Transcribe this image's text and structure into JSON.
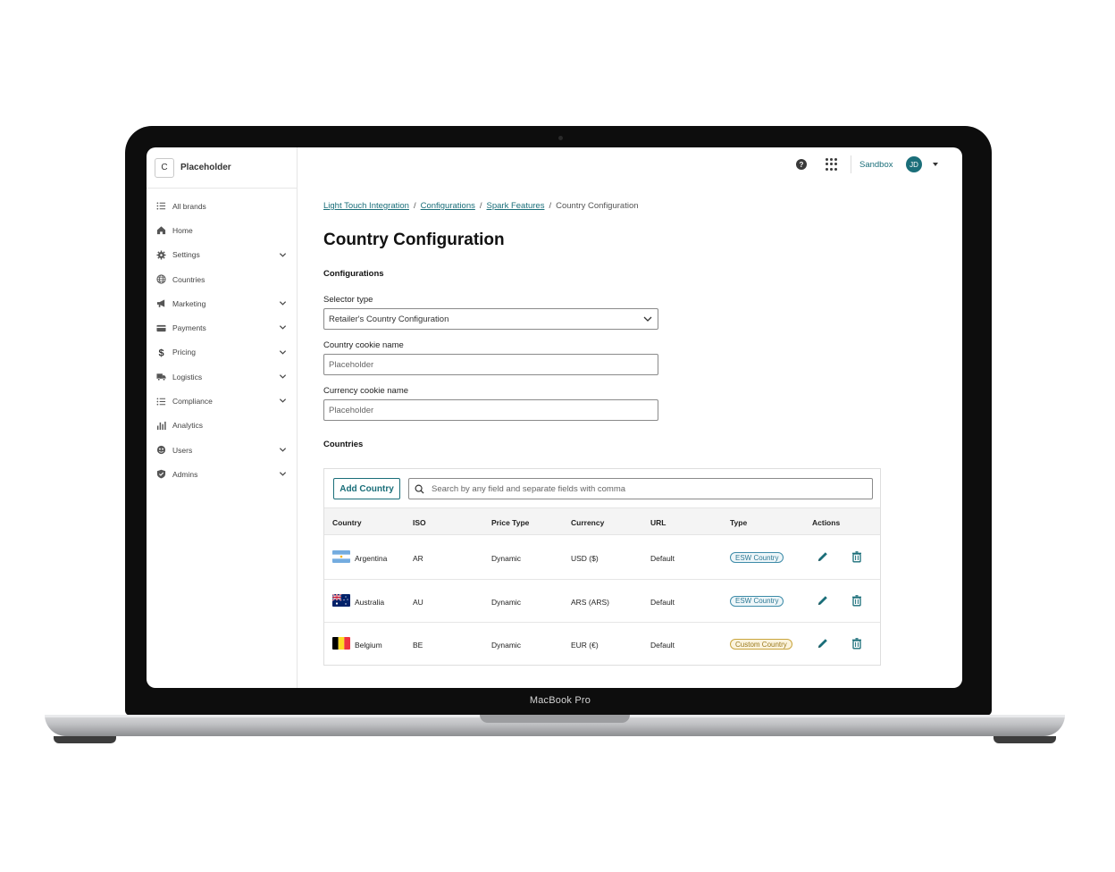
{
  "device": {
    "model_label": "MacBook Pro"
  },
  "sidebar": {
    "brand_initial": "C",
    "brand_name": "Placeholder",
    "items": [
      {
        "label": "All brands",
        "icon": "list-icon",
        "expandable": false
      },
      {
        "label": "Home",
        "icon": "home-icon",
        "expandable": false
      },
      {
        "label": "Settings",
        "icon": "gear-icon",
        "expandable": true
      },
      {
        "label": "Countries",
        "icon": "globe-icon",
        "expandable": false
      },
      {
        "label": "Marketing",
        "icon": "megaphone-icon",
        "expandable": true
      },
      {
        "label": "Payments",
        "icon": "credit-card-icon",
        "expandable": true
      },
      {
        "label": "Pricing",
        "icon": "dollar-icon",
        "expandable": true
      },
      {
        "label": "Logistics",
        "icon": "truck-icon",
        "expandable": true
      },
      {
        "label": "Compliance",
        "icon": "list-icon",
        "expandable": true
      },
      {
        "label": "Analytics",
        "icon": "bar-chart-icon",
        "expandable": false
      },
      {
        "label": "Users",
        "icon": "users-icon",
        "expandable": true
      },
      {
        "label": "Admins",
        "icon": "shield-icon",
        "expandable": true
      }
    ]
  },
  "topbar": {
    "help_icon": "question-circle-icon",
    "help_glyph": "?",
    "apps_icon": "apps-grid-icon",
    "environment": "Sandbox",
    "avatar_initials": "JD"
  },
  "breadcrumb": {
    "links": [
      "Light Touch Integration",
      "Configurations",
      "Spark Features"
    ],
    "separator": "/",
    "current": "Country Configuration"
  },
  "page_title": "Country Configuration",
  "configurations": {
    "section_title": "Configurations",
    "selector_type_label": "Selector type",
    "selector_type_value": "Retailer's Country Configuration",
    "country_cookie_label": "Country cookie name",
    "country_cookie_placeholder": "Placeholder",
    "currency_cookie_label": "Currency cookie name",
    "currency_cookie_placeholder": "Placeholder"
  },
  "countries": {
    "section_title": "Countries",
    "add_button": "Add Country",
    "search_placeholder": "Search by any field and separate fields with comma",
    "columns": [
      "Country",
      "ISO",
      "Price Type",
      "Currency",
      "URL",
      "Type",
      "Actions"
    ],
    "rows": [
      {
        "country": "Argentina",
        "flag": "argentina-flag",
        "iso": "AR",
        "price_type": "Dynamic",
        "currency": "USD ($)",
        "url": "Default",
        "type": "ESW Country",
        "type_style": "esw"
      },
      {
        "country": "Australia",
        "flag": "australia-flag",
        "iso": "AU",
        "price_type": "Dynamic",
        "currency": "ARS (ARS)",
        "url": "Default",
        "type": "ESW Country",
        "type_style": "esw"
      },
      {
        "country": "Belgium",
        "flag": "belgium-flag",
        "iso": "BE",
        "price_type": "Dynamic",
        "currency": "EUR (€)",
        "url": "Default",
        "type": "Custom Country",
        "type_style": "custom"
      }
    ],
    "action_icons": [
      "pencil-icon",
      "trash-icon"
    ]
  },
  "colors": {
    "accent": "#1a6e79",
    "badge_esw": "#3d8ba8",
    "badge_custom": "#c9a53e"
  }
}
